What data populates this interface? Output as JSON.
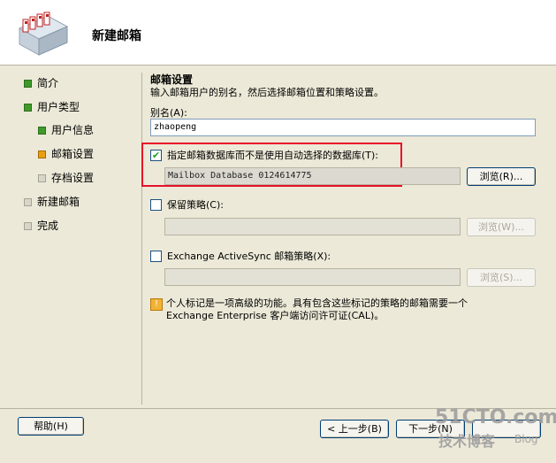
{
  "header": {
    "title": "新建邮箱"
  },
  "nav": {
    "items": [
      {
        "label": "简介",
        "state": "done"
      },
      {
        "label": "用户类型",
        "state": "done"
      },
      {
        "label": "用户信息",
        "state": "done"
      },
      {
        "label": "邮箱设置",
        "state": "current"
      },
      {
        "label": "存档设置",
        "state": "pending"
      },
      {
        "label": "新建邮箱",
        "state": "pending"
      },
      {
        "label": "完成",
        "state": "pending"
      }
    ]
  },
  "main": {
    "section_title": "邮箱设置",
    "section_desc": "输入邮箱用户的别名，然后选择邮箱位置和策略设置。",
    "alias_label": "别名(A):",
    "alias_value": "zhaopeng",
    "database": {
      "label": "指定邮箱数据库而不是使用自动选择的数据库(T):",
      "checked": true,
      "value": "Mailbox Database 0124614775",
      "browse_label": "浏览(R)..."
    },
    "retention": {
      "label": "保留策略(C):",
      "checked": false,
      "value": "",
      "browse_label": "浏览(W)..."
    },
    "activesync": {
      "label": "Exchange ActiveSync 邮箱策略(X):",
      "checked": false,
      "value": "",
      "browse_label": "浏览(S)..."
    },
    "info": {
      "icon": "warning-info-icon",
      "line1": "个人标记是一项高级的功能。具有包含这些标记的策略的邮箱需要一个",
      "line2": "Exchange Enterprise 客户端访问许可证(CAL)。"
    }
  },
  "footer": {
    "help_label": "帮助(H)",
    "back_label": "< 上一步(B)",
    "next_label": "下一步(N)",
    "watermark_main": "51CTO.com",
    "watermark_sub": "技术博客",
    "watermark_blog": "Blog"
  },
  "colors": {
    "highlight_box": "#e8102a",
    "done": "#3f9a2a",
    "current": "#e8a012",
    "pending": "#d8d6c8"
  }
}
